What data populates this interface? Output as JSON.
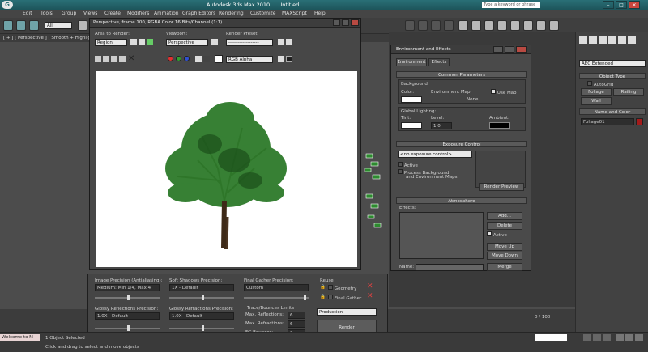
{
  "titlebar": {
    "app_title": "Autodesk 3ds Max 2010",
    "file_name": "Untitled",
    "search_placeholder": "Type a keyword or phrase",
    "min_label": "–",
    "max_label": "□",
    "close_label": "✕",
    "app_icon": "3ds-max-logo"
  },
  "menu": [
    "Edit",
    "Tools",
    "Group",
    "Views",
    "Create",
    "Modifiers",
    "Animation",
    "Graph Editors",
    "Rendering",
    "Customize",
    "MAXScript",
    "Help"
  ],
  "toolbar": {
    "selection_filter": "All"
  },
  "viewport": {
    "label": "[ + ] [ Perspective ] [ Smooth + Highlights + E"
  },
  "frame_window": {
    "title": "Perspective, frame 100, RGBA Color 16 Bits/Channel (1:1)",
    "area_to_render_label": "Area to Render:",
    "area_to_render_value": "Region",
    "viewport_label": "Viewport:",
    "viewport_value": "Perspective",
    "render_preset_label": "Render Preset:",
    "render_preset_value": "-------------------",
    "channel_value": "RGB Alpha"
  },
  "env_dialog": {
    "title": "Environment and Effects",
    "tab_environment": "Environment",
    "tab_effects": "Effects",
    "common_parameters": "Common Parameters",
    "background_label": "Background:",
    "color_label": "Color:",
    "env_map_label": "Environment Map:",
    "use_map_label": "Use Map",
    "none_label": "None",
    "global_lighting_label": "Global Lighting:",
    "tint_label": "Tint:",
    "level_label": "Level:",
    "level_value": "1.0",
    "ambient_label": "Ambient:",
    "exposure_control": "Exposure Control",
    "exposure_value": "<no exposure control>",
    "active_label": "Active",
    "process_bg_label": "Process Background",
    "process_bg_label2": "and Environment Maps",
    "render_preview": "Render Preview",
    "atmosphere": "Atmosphere",
    "effects_label": "Effects:",
    "add_button": "Add...",
    "delete_button": "Delete",
    "active2_label": "Active",
    "move_up": "Move Up",
    "move_down": "Move Down",
    "name_label": "Name:",
    "merge_button": "Merge"
  },
  "render_settings": {
    "image_precision_label": "Image Precision (Antialiasing):",
    "image_precision_value": "Medium: Min 1/4, Max 4",
    "soft_shadows_label": "Soft Shadows Precision:",
    "soft_shadows_value": "1X - Default",
    "final_gather_label": "Final Gather Precision:",
    "final_gather_value": "Custom",
    "reuse_label": "Reuse",
    "geometry_label": "Geometry",
    "final_gather_check": "Final Gather",
    "glossy_reflections_label": "Glossy Reflections Precision:",
    "glossy_reflections_value": "1.0X - Default",
    "glossy_refractions_label": "Glossy Refractions Precision:",
    "glossy_refractions_value": "1.0X - Default",
    "trace_bounces_label": "Trace/Bounces Limits",
    "max_reflections_label": "Max. Reflections:",
    "max_reflections_value": "6",
    "max_refractions_label": "Max. Refractions:",
    "max_refractions_value": "6",
    "fg_bounces_label": "FG Bounces:",
    "fg_bounces_value": "0",
    "preset_value": "Production",
    "render_button": "Render"
  },
  "command_panel": {
    "category_value": "AEC Extended",
    "object_type": "Object Type",
    "autogrid_label": "AutoGrid",
    "foliage": "Foliage",
    "railing": "Railing",
    "wall": "Wall",
    "name_and_color": "Name and Color",
    "object_name": "Foliage01",
    "object_color": "#a51b1b"
  },
  "status": {
    "listener": "Welcome to M",
    "selection": "1 Object Selected",
    "prompt": "Click and drag to select and move objects",
    "timeline": "0 / 100"
  },
  "colors": {
    "titlebar": "#2a6f76",
    "background_swatch": "#ffffff",
    "tint_swatch": "#ffffff",
    "ambient_swatch": "#000000",
    "foliage_green": "#2d7a2a"
  }
}
